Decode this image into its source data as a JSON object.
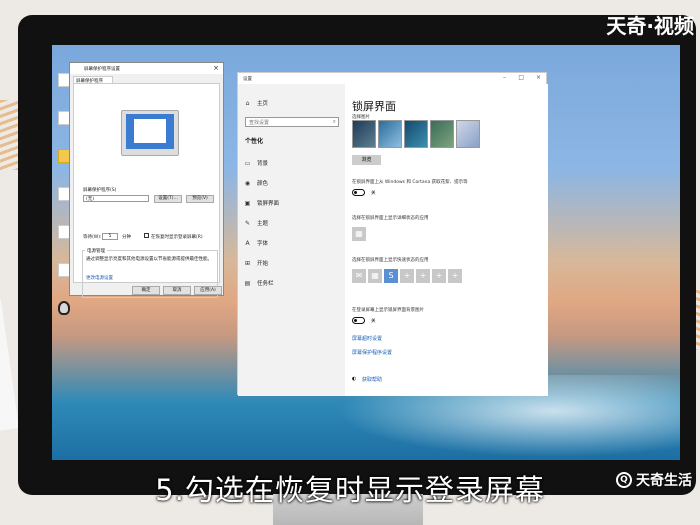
{
  "watermark": {
    "top": "天奇·视频",
    "bottom": "天奇生活"
  },
  "subtitle": "5.勾选在恢复时显示登录屏幕",
  "screensaver_dialog": {
    "title": "屏幕保护程序设置",
    "tab": "屏幕保护程序",
    "screensaver_label": "屏幕保护程序(S)",
    "screensaver_value": "(无)",
    "settings_button": "设置(T)...",
    "preview_button": "预览(V)",
    "wait_label": "等待(W):",
    "wait_value": "5",
    "wait_unit": "分钟",
    "resume_checkbox_label": "在恢复时显示登录屏幕(R)",
    "power_group_title": "电源管理",
    "power_desc": "通过调整显示亮度和其他电源设置以节省能源或提供最佳性能。",
    "power_link": "更改电源设置",
    "ok": "确定",
    "cancel": "取消",
    "apply": "应用(A)"
  },
  "settings_window": {
    "title": "设置",
    "sidebar": {
      "home": "主页",
      "search_placeholder": "查找设置",
      "section": "个性化",
      "items": [
        {
          "label": "背景",
          "icon": "picture-icon"
        },
        {
          "label": "颜色",
          "icon": "palette-icon"
        },
        {
          "label": "锁屏界面",
          "icon": "lock-screen-icon"
        },
        {
          "label": "主题",
          "icon": "brush-icon"
        },
        {
          "label": "字体",
          "icon": "font-icon"
        },
        {
          "label": "开始",
          "icon": "start-icon"
        },
        {
          "label": "任务栏",
          "icon": "taskbar-icon"
        }
      ]
    },
    "main": {
      "title": "锁屏界面",
      "sub": "选择图片",
      "browse": "浏览",
      "show_info_label": "在锁屏界面上从 Windows 和 Cortana 获取花絮、提示等",
      "toggle1": "关",
      "detail_app_label": "选择在锁屏界面上显示详细状态的应用",
      "quick_apps_label": "选择在锁屏界面上显示快速状态的应用",
      "signin_bg_label": "在登录屏幕上显示锁屏界面背景图片",
      "toggle2": "关",
      "timeout_link": "屏幕超时设置",
      "screensaver_link": "屏幕保护程序设置",
      "help_link": "获取帮助"
    }
  }
}
